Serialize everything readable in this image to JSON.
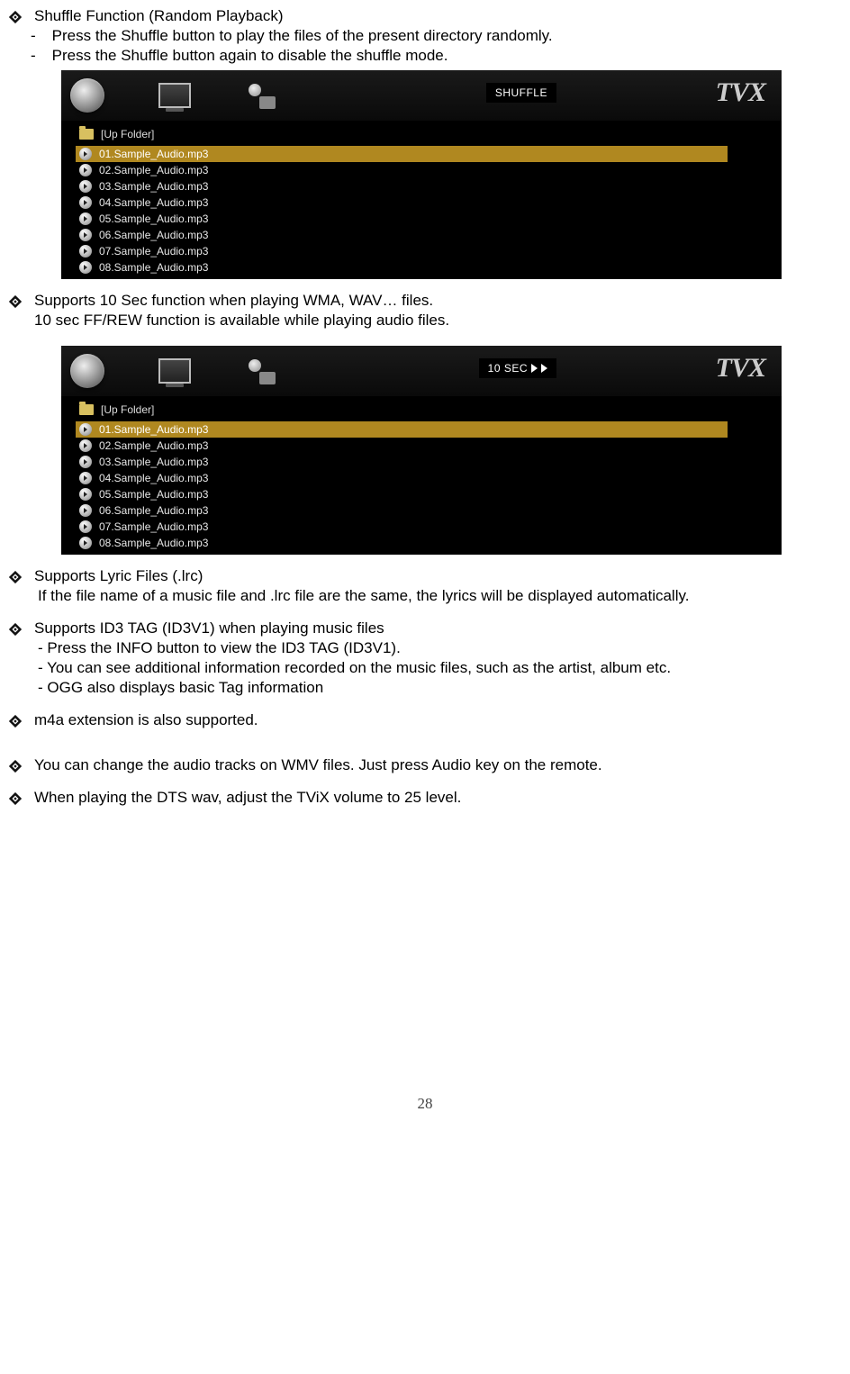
{
  "bullet1": {
    "title": "Shuffle Function (Random Playback)",
    "dash1": "Press the Shuffle button to play the files of the present directory randomly.",
    "dash2": "Press the Shuffle button again to disable the shuffle mode."
  },
  "screenshot1": {
    "badge": "SHUFFLE",
    "logo": "TVX",
    "upfolder": "[Up Folder]",
    "files": [
      "01.Sample_Audio.mp3",
      "02.Sample_Audio.mp3",
      "03.Sample_Audio.mp3",
      "04.Sample_Audio.mp3",
      "05.Sample_Audio.mp3",
      "06.Sample_Audio.mp3",
      "07.Sample_Audio.mp3",
      "08.Sample_Audio.mp3"
    ]
  },
  "bullet2": {
    "line1": "Supports 10 Sec function when playing WMA, WAV… files.",
    "line2": "10 sec FF/REW function is available while playing audio files."
  },
  "screenshot2": {
    "badge": "10 SEC",
    "logo": "TVX",
    "upfolder": "[Up Folder]",
    "files": [
      "01.Sample_Audio.mp3",
      "02.Sample_Audio.mp3",
      "03.Sample_Audio.mp3",
      "04.Sample_Audio.mp3",
      "05.Sample_Audio.mp3",
      "06.Sample_Audio.mp3",
      "07.Sample_Audio.mp3",
      "08.Sample_Audio.mp3"
    ]
  },
  "bullet3": {
    "line1": "Supports Lyric Files (.lrc)",
    "line2": "If the file name of a music file and .lrc file are the same, the lyrics will be displayed automatically."
  },
  "bullet4": {
    "line1": "Supports ID3 TAG (ID3V1) when playing music files",
    "line2": "- Press the INFO button to view the ID3 TAG (ID3V1).",
    "line3": "- You can see additional information recorded on the music files, such as the artist, album etc.",
    "line4": "- OGG also displays basic Tag information"
  },
  "bullet5": {
    "line1": "m4a extension is also supported."
  },
  "bullet6": {
    "line1": "You can change the audio tracks on WMV files.    Just press Audio key on the remote."
  },
  "bullet7": {
    "line1": "When playing the DTS wav, adjust the TViX volume to 25 level."
  },
  "pageNumber": "28"
}
